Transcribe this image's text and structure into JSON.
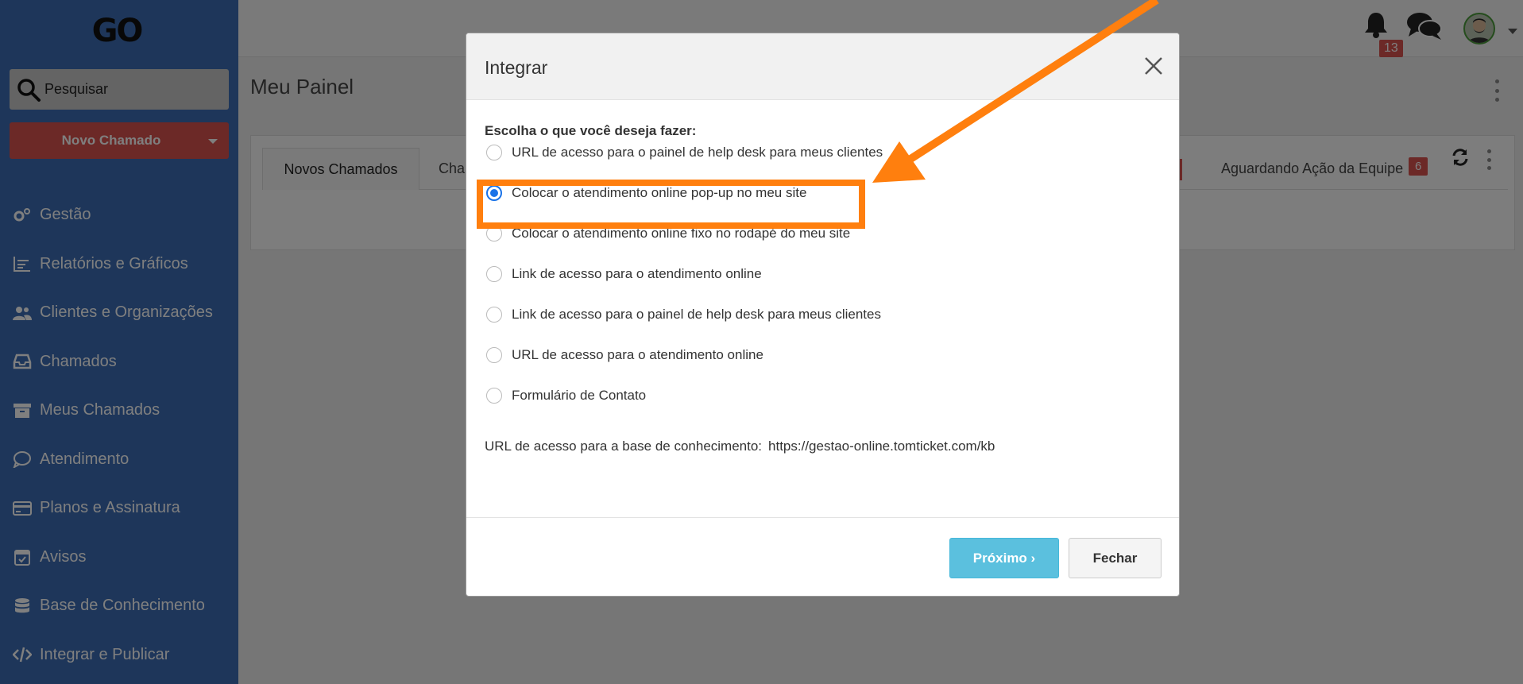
{
  "app": {
    "logo_text": "GO",
    "search_placeholder": "Pesquisar",
    "new_ticket_label": "Novo Chamado",
    "notification_count": "13",
    "page_title": "Meu Painel"
  },
  "sidebar": {
    "items": [
      {
        "label": "Gestão",
        "icon": "gears-icon"
      },
      {
        "label": "Relatórios e Gráficos",
        "icon": "chart-icon"
      },
      {
        "label": "Clientes e Organizações",
        "icon": "users-icon"
      },
      {
        "label": "Chamados",
        "icon": "inbox-icon"
      },
      {
        "label": "Meus Chamados",
        "icon": "archive-icon"
      },
      {
        "label": "Atendimento",
        "icon": "comment-icon"
      },
      {
        "label": "Planos e Assinatura",
        "icon": "credit-card-icon"
      },
      {
        "label": "Avisos",
        "icon": "calendar-check-icon"
      },
      {
        "label": "Base de Conhecimento",
        "icon": "database-icon"
      },
      {
        "label": "Integrar e Publicar",
        "icon": "code-icon"
      }
    ]
  },
  "tabs": {
    "active": "Novos Chamados",
    "second_partial": "Cha",
    "last": "Aguardando Ação da Equipe",
    "last_badge": "6"
  },
  "modal": {
    "title": "Integrar",
    "prompt": "Escolha o que você deseja fazer:",
    "options": [
      {
        "label": "URL de acesso para o painel de help desk para meus clientes",
        "selected": false
      },
      {
        "label": "Colocar o atendimento online pop-up no meu site",
        "selected": true
      },
      {
        "label": "Colocar o atendimento online fixo no rodapé do meu site",
        "selected": false
      },
      {
        "label": "Link de acesso para o atendimento online",
        "selected": false
      },
      {
        "label": "Link de acesso para o painel de help desk para meus clientes",
        "selected": false
      },
      {
        "label": "URL de acesso para o atendimento online",
        "selected": false
      },
      {
        "label": "Formulário de Contato",
        "selected": false
      }
    ],
    "kb_label": "URL de acesso para a base de conhecimento:",
    "kb_url": "https://gestao-online.tomticket.com/kb",
    "next_button": "Próximo ›",
    "close_button": "Fechar"
  },
  "colors": {
    "sidebar": "#3c6db4",
    "danger": "#d9534f",
    "info": "#5bc0de",
    "annotation": "#ff7f0e",
    "radio_selected": "#1a73e8"
  }
}
